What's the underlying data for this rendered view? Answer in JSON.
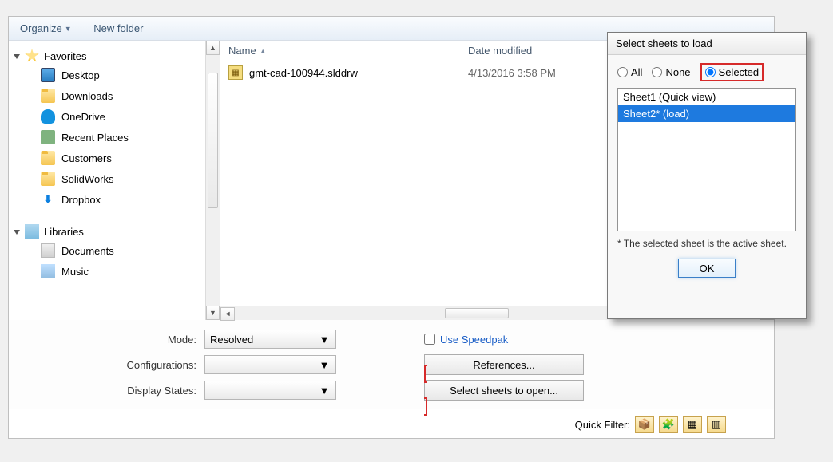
{
  "toolbar": {
    "organize": "Organize",
    "new_folder": "New folder"
  },
  "nav": {
    "favorites_header": "Favorites",
    "favorites": [
      {
        "label": "Desktop"
      },
      {
        "label": "Downloads"
      },
      {
        "label": "OneDrive"
      },
      {
        "label": "Recent Places"
      },
      {
        "label": "Customers"
      },
      {
        "label": "SolidWorks"
      },
      {
        "label": "Dropbox"
      }
    ],
    "libraries_header": "Libraries",
    "libraries": [
      {
        "label": "Documents"
      },
      {
        "label": "Music"
      }
    ]
  },
  "file_header": {
    "name": "Name",
    "date": "Date modified"
  },
  "files": [
    {
      "name": "gmt-cad-100944.slddrw",
      "date": "4/13/2016 3:58 PM"
    }
  ],
  "options": {
    "mode_label": "Mode:",
    "mode_value": "Resolved",
    "config_label": "Configurations:",
    "config_value": "",
    "dispstates_label": "Display States:",
    "dispstates_value": "",
    "speedpak": "Use Speedpak",
    "references_btn": "References...",
    "select_sheets_btn": "Select sheets to open...",
    "quick_filter_label": "Quick Filter:"
  },
  "modal": {
    "title": "Select sheets to load",
    "radio_all": "All",
    "radio_none": "None",
    "radio_selected": "Selected",
    "sheets": [
      {
        "text": "Sheet1 (Quick view)",
        "selected": false
      },
      {
        "text": "Sheet2* (load)",
        "selected": true
      }
    ],
    "footnote": "* The selected sheet is the active sheet.",
    "ok": "OK"
  }
}
